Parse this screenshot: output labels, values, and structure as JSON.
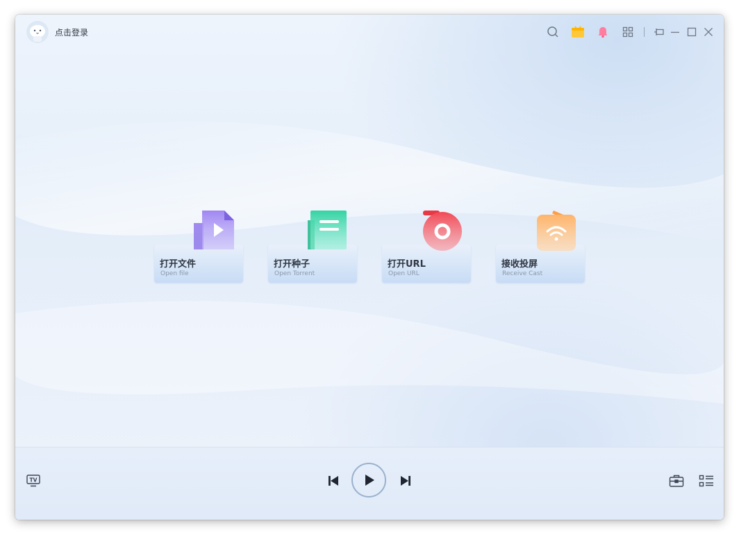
{
  "header": {
    "login_label": "点击登录"
  },
  "actions": [
    {
      "title": "打开文件",
      "subtitle": "Open file",
      "icon": "video-file-icon",
      "color": "#9b84f0"
    },
    {
      "title": "打开种子",
      "subtitle": "Open Torrent",
      "icon": "torrent-icon",
      "color": "#3dd6a8"
    },
    {
      "title": "打开URL",
      "subtitle": "Open URL",
      "icon": "url-record-icon",
      "color": "#f2545e"
    },
    {
      "title": "接收投屏",
      "subtitle": "Receive Cast",
      "icon": "cast-receive-icon",
      "color": "#ffb870"
    }
  ],
  "toolbar_icons": [
    "search-icon",
    "gift-icon",
    "notification-icon",
    "apps-grid-icon",
    "pin-icon",
    "minimize-icon",
    "maximize-icon",
    "close-icon"
  ],
  "bottom": {
    "tv_badge": "TV"
  },
  "colors": {
    "accent_blue": "#4a7bd0",
    "text_dark": "#2f3642",
    "text_sub": "#8a97ab"
  }
}
